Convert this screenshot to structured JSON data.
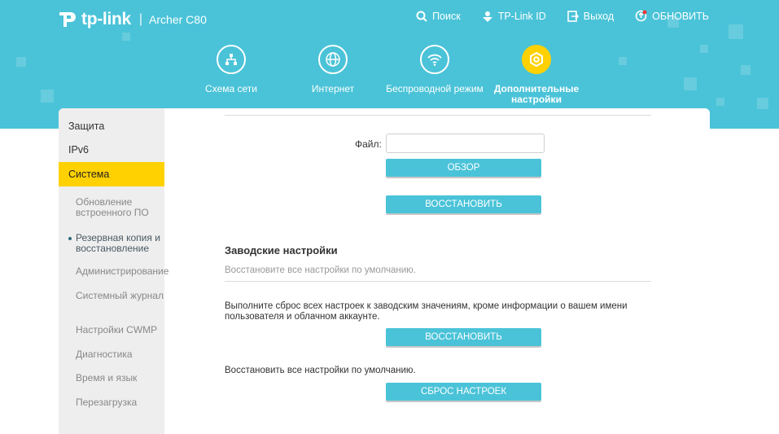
{
  "header": {
    "brand": "tp-link",
    "separator": "|",
    "model": "Archer C80",
    "nav": {
      "search": "Поиск",
      "tplink_id": "TP-Link ID",
      "logout": "Выход",
      "update": "ОБНОВИТЬ"
    }
  },
  "tabs": [
    {
      "label": "Схема сети",
      "icon": "network-map-icon"
    },
    {
      "label": "Интернет",
      "icon": "globe-icon"
    },
    {
      "label": "Беспроводной режим",
      "icon": "wifi-icon"
    },
    {
      "label": "Дополнительные настройки",
      "icon": "advanced-gear-icon",
      "active": true
    }
  ],
  "sidebar": {
    "items": [
      "Защита",
      "IPv6",
      "Система"
    ],
    "active": "Система",
    "subitems": [
      "Обновление встроенного ПО",
      "Резервная копия и восстановление",
      "Администрирование",
      "Системный журнал",
      "Настройки CWMP",
      "Диагностика",
      "Время и язык",
      "Перезагрузка"
    ],
    "current_sub": "Резервная копия и восстановление"
  },
  "restore": {
    "file_label": "Файл:",
    "file_value": "",
    "browse_button": "ОБЗОР",
    "restore_button": "ВОССТАНОВИТЬ"
  },
  "factory": {
    "title": "Заводские настройки",
    "subtitle": "Восстановите все настройки по умолчанию.",
    "reset_text": "Выполните сброс всех настроек к заводским значениям, кроме информации о вашем имени пользователя и облачном аккаунте.",
    "reset_button": "ВОССТАНОВИТЬ",
    "default_text": "Восстановить все настройки по умолчанию.",
    "default_button": "СБРОС НАСТРОЕК"
  },
  "colors": {
    "accent": "#4ac3d8",
    "active": "#ffd100",
    "sidebar_bg": "#eeeeee"
  }
}
